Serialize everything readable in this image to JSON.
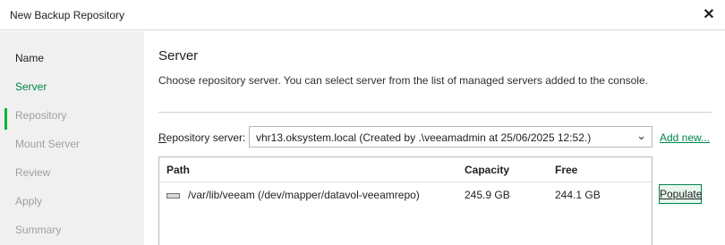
{
  "window": {
    "title": "New Backup Repository",
    "close_glyph": "✕"
  },
  "steps": [
    {
      "label": "Name",
      "state": "done"
    },
    {
      "label": "Server",
      "state": "active"
    },
    {
      "label": "Repository",
      "state": "pending"
    },
    {
      "label": "Mount Server",
      "state": "pending"
    },
    {
      "label": "Review",
      "state": "pending"
    },
    {
      "label": "Apply",
      "state": "pending"
    },
    {
      "label": "Summary",
      "state": "pending"
    }
  ],
  "section": {
    "title": "Server",
    "description": "Choose repository server. You can select server from the list of managed servers added to the console."
  },
  "repository_server": {
    "label": "Repository server:",
    "value": "vhr13.oksystem.local (Created by .\\veeamadmin at 25/06/2025 12:52.)",
    "add_new": "Add new..."
  },
  "grid": {
    "columns": [
      "Path",
      "Capacity",
      "Free"
    ],
    "rows": [
      {
        "path": "/var/lib/veeam (/dev/mapper/datavol-veeamrepo)",
        "capacity": "245.9 GB",
        "free": "244.1 GB"
      }
    ]
  },
  "populate_label": "Populate",
  "colors": {
    "accent": "#00b336",
    "link": "#00854a",
    "sidebar_bg": "#f0f0f0"
  }
}
